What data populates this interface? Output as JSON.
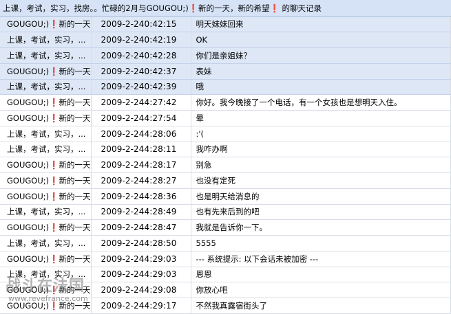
{
  "window": {
    "title": "上课，考试，实习，找房。。忙碌的2月与GOUGOU;)❗新的一天，新的希望❗ 的聊天记录"
  },
  "chat_rows": [
    {
      "sender": "GOUGOU;)❗新的一天",
      "time": "2009-2-240:42:15",
      "message": "明天妹妹回来",
      "selected": true
    },
    {
      "sender": "上课，考试，实习，找房",
      "time": "2009-2-240:42:19",
      "message": "OK",
      "selected": true
    },
    {
      "sender": "上课，考试，实习，找房",
      "time": "2009-2-240:42:28",
      "message": "你们是亲姐妹？",
      "selected": true
    },
    {
      "sender": "GOUGOU;)❗新的一天",
      "time": "2009-2-240:42:37",
      "message": "表妹",
      "selected": true
    },
    {
      "sender": "上课，考试，实习，找房",
      "time": "2009-2-240:42:39",
      "message": "哦",
      "selected": true
    },
    {
      "sender": "GOUGOU;)❗新的一天",
      "time": "2009-2-244:27:42",
      "message": "你好。我今晚接了一个电话，有一个女孩也是想明天入住。",
      "selected": false
    },
    {
      "sender": "GOUGOU;)❗新的一天",
      "time": "2009-2-244:27:54",
      "message": "晕",
      "selected": false
    },
    {
      "sender": "上课，考试，实习，找房",
      "time": "2009-2-244:28:06",
      "message": ":'(",
      "selected": false
    },
    {
      "sender": "上课，考试，实习，找房",
      "time": "2009-2-244:28:11",
      "message": "我咋办啊",
      "selected": false
    },
    {
      "sender": "GOUGOU;)❗新的一天",
      "time": "2009-2-244:28:17",
      "message": "别急",
      "selected": false
    },
    {
      "sender": "GOUGOU;)❗新的一天",
      "time": "2009-2-244:28:27",
      "message": "也没有定死",
      "selected": false
    },
    {
      "sender": "GOUGOU;)❗新的一天",
      "time": "2009-2-244:28:36",
      "message": "也是明天给消息的",
      "selected": false
    },
    {
      "sender": "上课，考试，实习，找房",
      "time": "2009-2-244:28:49",
      "message": "也有先来后到的吧",
      "selected": false
    },
    {
      "sender": "GOUGOU;)❗新的一天",
      "time": "2009-2-244:28:47",
      "message": "我就是告诉你一下。",
      "selected": false
    },
    {
      "sender": "上课，考试，实习，找房",
      "time": "2009-2-244:28:50",
      "message": "5555",
      "selected": false
    },
    {
      "sender": "GOUGOU;)❗新的一天",
      "time": "2009-2-244:29:03",
      "message": "--- 系统提示: 以下会话未被加密 ---",
      "selected": false
    },
    {
      "sender": "上课，考试，实习，找房",
      "time": "2009-2-244:29:03",
      "message": "恩恩",
      "selected": false
    },
    {
      "sender": "GOUGOU;)❗新的一天",
      "time": "2009-2-244:29:08",
      "message": "你放心吧",
      "selected": false
    },
    {
      "sender": "GOUGOU;)❗新的一天",
      "time": "2009-2-244:29:17",
      "message": "不然我真露宿街头了",
      "selected": false
    }
  ],
  "watermark": {
    "main": "战斗在法国",
    "url": "www.revefrance.com"
  }
}
